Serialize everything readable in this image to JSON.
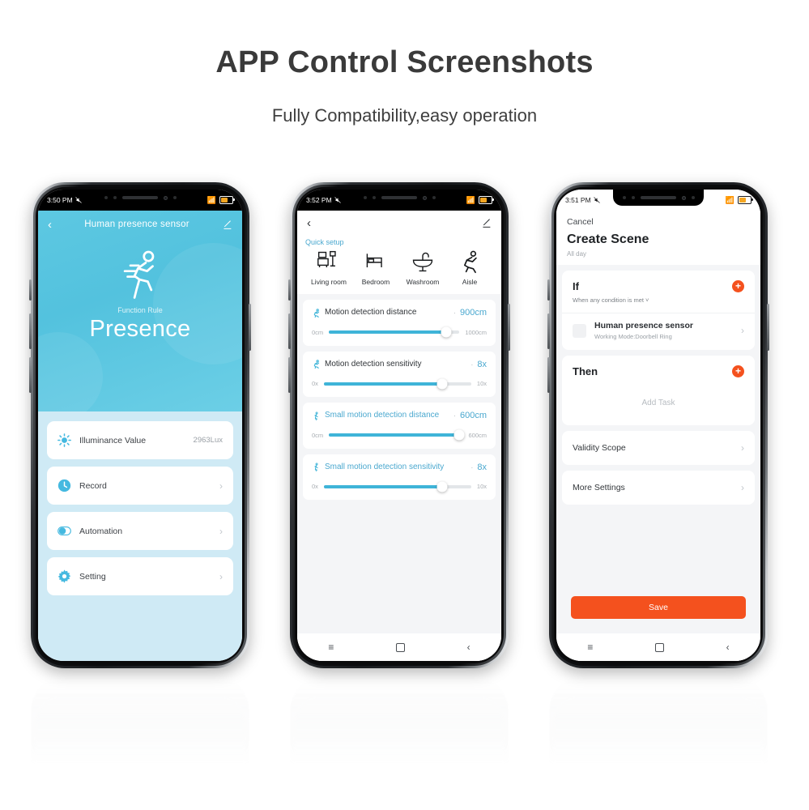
{
  "header": {
    "title": "APP Control Screenshots",
    "subtitle": "Fully Compatibility,easy operation"
  },
  "phone1": {
    "status": {
      "time": "3:50 PM",
      "mute_icon": "mute-icon",
      "wifi_icon": "wifi-icon",
      "battery_icon": "battery-icon"
    },
    "nav": {
      "back_icon": "back-chevron-icon",
      "title": "Human presence sensor",
      "edit_icon": "pencil-edit-icon"
    },
    "hero": {
      "icon": "running-person-icon",
      "rule_label": "Function Rule",
      "rule_value": "Presence"
    },
    "cards": [
      {
        "icon": "brightness-icon",
        "label": "Illuminance Value",
        "value": "2963Lux",
        "arrow": ""
      },
      {
        "icon": "clock-icon",
        "label": "Record",
        "value": "",
        "arrow": "›"
      },
      {
        "icon": "toggle-icon",
        "label": "Automation",
        "value": "",
        "arrow": "›"
      },
      {
        "icon": "gear-icon",
        "label": "Setting",
        "value": "",
        "arrow": "›"
      }
    ],
    "navbar": {
      "menu": "≡",
      "home": "",
      "back": "‹"
    }
  },
  "phone2": {
    "status": {
      "time": "3:52 PM",
      "mute_icon": "mute-icon",
      "wifi_icon": "wifi-icon",
      "battery_icon": "battery-icon"
    },
    "nav": {
      "back_icon": "back-chevron-icon",
      "edit_icon": "pencil-edit-icon"
    },
    "quick_setup": {
      "title": "Quick setup",
      "items": [
        {
          "icon": "sofa-icon",
          "label": "Living room"
        },
        {
          "icon": "bed-icon",
          "label": "Bedroom"
        },
        {
          "icon": "sink-icon",
          "label": "Washroom"
        },
        {
          "icon": "running-person-icon",
          "label": "Aisle"
        }
      ]
    },
    "sliders": [
      {
        "icon": "running-person-icon",
        "name": "Motion detection distance",
        "sep": "·",
        "value": "900cm",
        "min": "0cm",
        "max": "1000cm",
        "percent": 90,
        "blue_label": false
      },
      {
        "icon": "running-person-icon",
        "name": "Motion detection sensitivity",
        "sep": "·",
        "value": "8x",
        "min": "0x",
        "max": "10x",
        "percent": 80,
        "blue_label": false
      },
      {
        "icon": "small-motion-icon",
        "name": "Small motion detection distance",
        "sep": "·",
        "value": "600cm",
        "min": "0cm",
        "max": "600cm",
        "percent": 97,
        "blue_label": true
      },
      {
        "icon": "small-motion-icon",
        "name": "Small motion detection sensitivity",
        "sep": "·",
        "value": "8x",
        "min": "0x",
        "max": "10x",
        "percent": 80,
        "blue_label": true
      }
    ],
    "navbar": {
      "menu": "≡",
      "home": "",
      "back": "‹"
    }
  },
  "phone3": {
    "status": {
      "time": "3:51 PM",
      "mute_icon": "mute-icon",
      "wifi_icon": "wifi-icon",
      "battery_icon": "battery-icon"
    },
    "cancel": "Cancel",
    "title": "Create Scene",
    "all_day": "All day",
    "if_card": {
      "heading": "If",
      "condition": "When any condition is met ˅",
      "add_icon": "plus-icon",
      "device": {
        "thumb": "device-thumb-icon",
        "name": "Human presence sensor",
        "sub": "Working Mode:Doorbell Ring",
        "arrow": "›"
      }
    },
    "then_card": {
      "heading": "Then",
      "add_icon": "plus-icon",
      "placeholder": "Add Task"
    },
    "rows": [
      {
        "label": "Validity Scope",
        "arrow": "›"
      },
      {
        "label": "More Settings",
        "arrow": "›"
      }
    ],
    "save_label": "Save",
    "navbar": {
      "menu": "≡",
      "home": "",
      "back": "‹"
    }
  },
  "colors": {
    "accent_cyan": "#3fb4d8",
    "hero_cyan": "#5dc8e2",
    "orange": "#f4511e",
    "body_blue": "#cfeaf5"
  }
}
